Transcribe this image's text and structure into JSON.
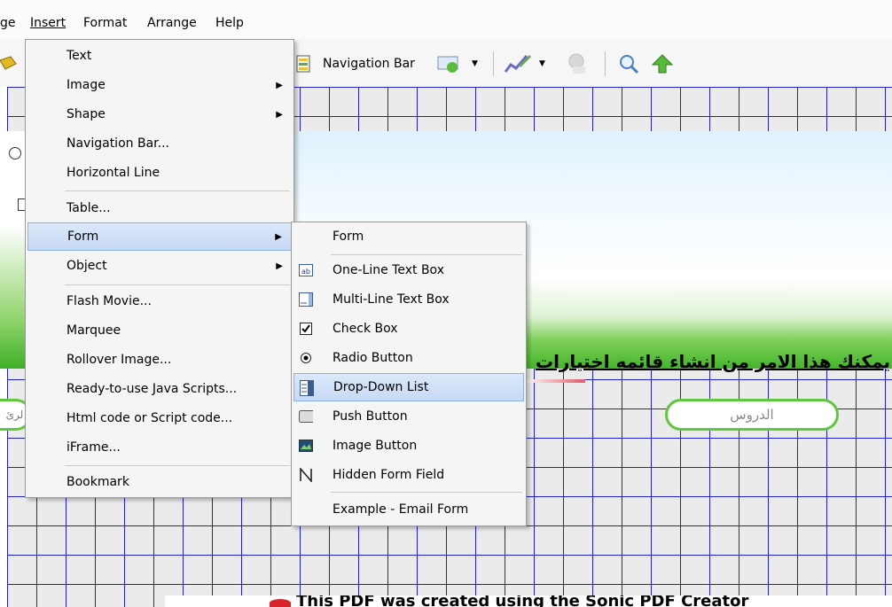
{
  "menubar": {
    "items": [
      "ge",
      "Insert",
      "Format",
      "Arrange",
      "Help"
    ]
  },
  "toolbar": {
    "navigation_bar_label": "Navigation Bar"
  },
  "insert_menu": {
    "items": [
      {
        "label": "Text",
        "has_submenu": false
      },
      {
        "label": "Image",
        "has_submenu": true
      },
      {
        "label": "Shape",
        "has_submenu": true
      },
      {
        "label": "Navigation Bar...",
        "has_submenu": false
      },
      {
        "label": "Horizontal Line",
        "has_submenu": false
      },
      {
        "label": "Table...",
        "has_submenu": false
      },
      {
        "label": "Form",
        "has_submenu": true,
        "active": true
      },
      {
        "label": "Object",
        "has_submenu": true
      },
      {
        "label": "Flash Movie...",
        "has_submenu": false
      },
      {
        "label": "Marquee",
        "has_submenu": false
      },
      {
        "label": "Rollover Image...",
        "has_submenu": false
      },
      {
        "label": "Ready-to-use Java Scripts...",
        "has_submenu": false
      },
      {
        "label": "Html code or Script code...",
        "has_submenu": false
      },
      {
        "label": "iFrame...",
        "has_submenu": false
      },
      {
        "label": "Bookmark",
        "has_submenu": false
      }
    ]
  },
  "form_submenu": {
    "items": [
      {
        "label": "Form",
        "icon": "none"
      },
      {
        "label": "One-Line Text Box",
        "icon": "textbox-icon"
      },
      {
        "label": "Multi-Line Text Box",
        "icon": "textarea-icon"
      },
      {
        "label": "Check Box",
        "icon": "checkbox-icon"
      },
      {
        "label": "Radio Button",
        "icon": "radio-icon"
      },
      {
        "label": "Drop-Down List",
        "icon": "dropdown-icon",
        "active": true
      },
      {
        "label": "Push Button",
        "icon": "push-button-icon"
      },
      {
        "label": "Image Button",
        "icon": "image-button-icon"
      },
      {
        "label": "Hidden Form Field",
        "icon": "hidden-field-icon"
      },
      {
        "label": "Example - Email Form",
        "icon": "none"
      }
    ]
  },
  "canvas": {
    "arabic_text": "يمكنك هذا الامر من انشاء قائمه اختيارات",
    "pill_button_text": "الدروس",
    "pill_left_text": "لرئ",
    "pdf_notice": "This PDF was created using the Sonic PDF Creator"
  },
  "colors": {
    "grid": "#2020c8",
    "menu_highlight": "#c6d9f5",
    "pill_border": "#5fc73d"
  }
}
